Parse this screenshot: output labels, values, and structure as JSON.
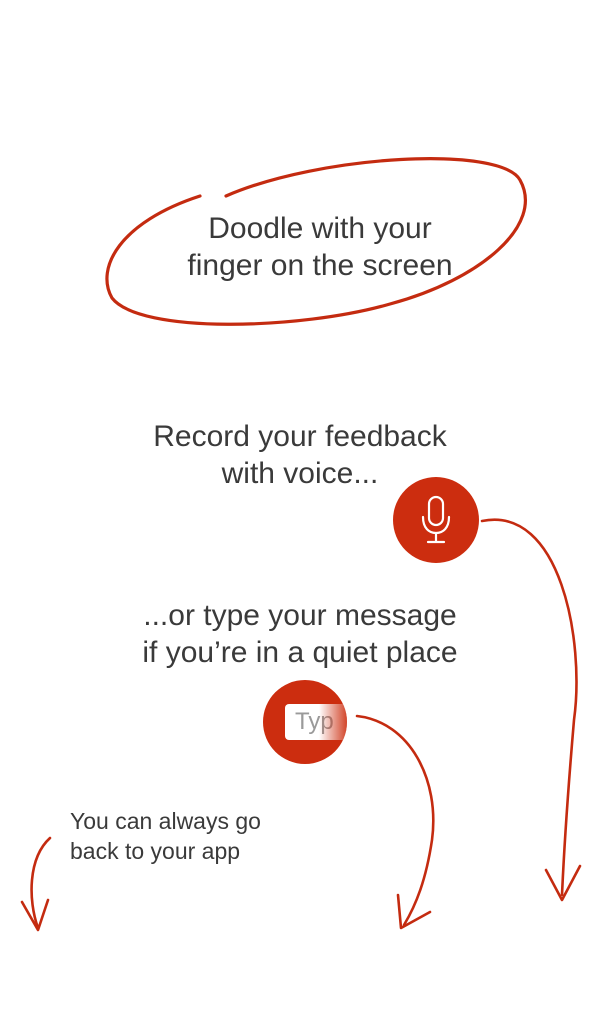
{
  "doodle_tip": {
    "line1": "Doodle with your",
    "line2": "finger on the screen"
  },
  "voice_tip": {
    "line1": "Record your feedback",
    "line2": "with voice..."
  },
  "type_tip": {
    "line1": "...or type your message",
    "line2": "if you’re in a quiet place"
  },
  "type_button": {
    "placeholder": "Typ"
  },
  "back_tip": {
    "line1": "You can always go",
    "line2": "back to your app"
  },
  "icons": {
    "mic_button": "microphone-icon",
    "arrows": "hand-drawn-arrow-icon",
    "doodle": "hand-drawn-ellipse"
  },
  "colors": {
    "accent": "#cc2d0f",
    "text": "#3a3a3a",
    "background": "#ffffff",
    "placeholder": "#9a9a9a"
  }
}
